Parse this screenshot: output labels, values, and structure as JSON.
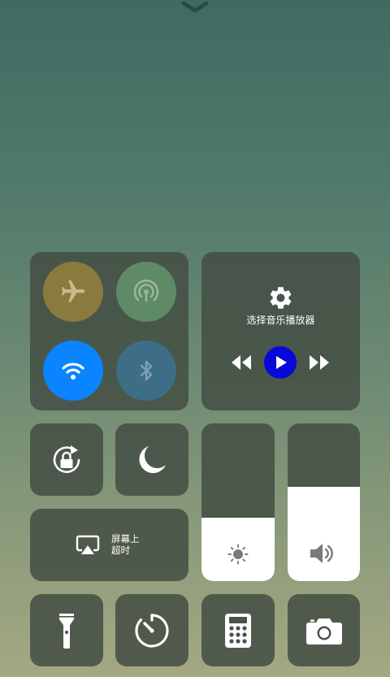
{
  "control_center": {
    "connectivity": {
      "airplane": {
        "icon": "airplane-icon",
        "color": "#8a7a3e",
        "active": false
      },
      "cellular": {
        "icon": "cellular-data-icon",
        "color": "#5f8a68",
        "active": false
      },
      "wifi": {
        "icon": "wifi-icon",
        "color": "#0a84ff",
        "active": true
      },
      "bluetooth": {
        "icon": "bluetooth-icon",
        "color": "#3d6e86",
        "active": false
      }
    },
    "music": {
      "label": "选择音乐播放器",
      "icons": [
        "gear-icon",
        "rewind-icon",
        "play-icon",
        "fast-forward-icon"
      ],
      "play_button_color": "#0a08d8"
    },
    "orientation_lock": {
      "icon": "rotation-lock-icon"
    },
    "do_not_disturb": {
      "icon": "moon-icon"
    },
    "screen_mirroring": {
      "icon": "airplay-icon",
      "label_line1": "屏幕上",
      "label_line2": "超时"
    },
    "brightness": {
      "icon": "sun-icon",
      "level_percent": 40
    },
    "volume": {
      "icon": "speaker-icon",
      "level_percent": 60
    },
    "shortcuts": [
      {
        "icon": "flashlight-icon"
      },
      {
        "icon": "timer-icon"
      },
      {
        "icon": "calculator-icon"
      },
      {
        "icon": "camera-icon"
      }
    ]
  }
}
